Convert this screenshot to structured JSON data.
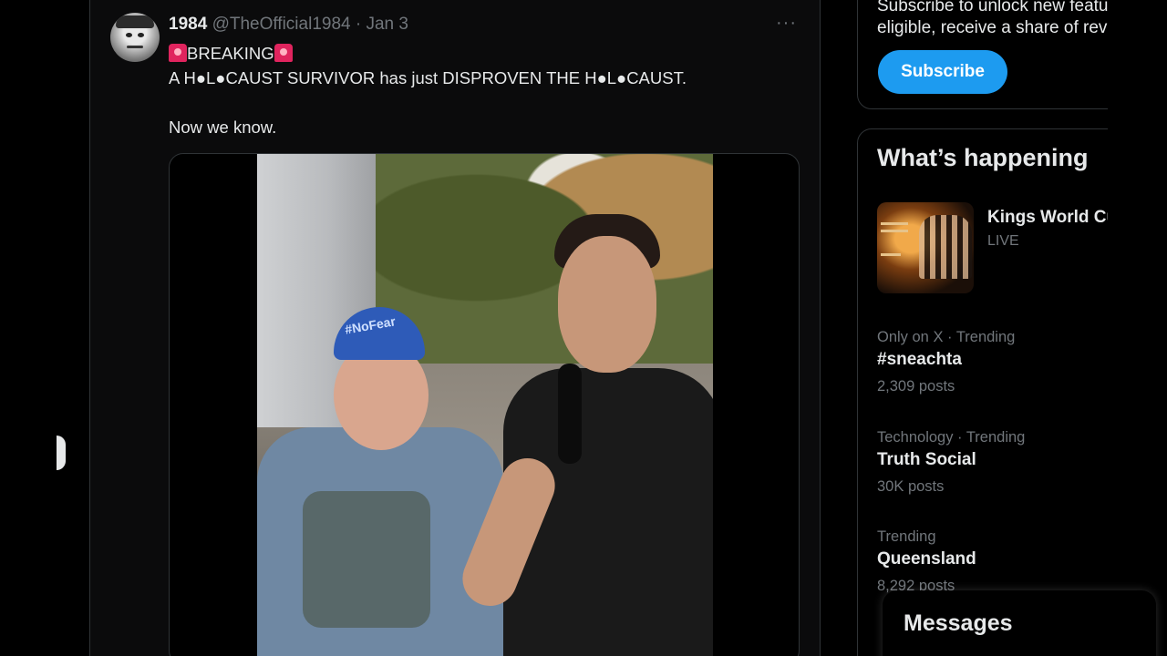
{
  "tweet": {
    "display_name": "1984",
    "handle": "@TheOfficial1984",
    "separator": "·",
    "date": "Jan 3",
    "more": "···",
    "line1": "BREAKING",
    "line2": "A H●L●CAUST SURVIVOR has just  DISPROVEN THE H●L●CAUST.",
    "line3": "Now we know.",
    "video_cap_text": "#NoFear"
  },
  "sidebar": {
    "premium_text_line1": "Subscribe to unlock new features and if",
    "premium_text_line2": "eligible, receive a share of revenue.",
    "subscribe_label": "Subscribe",
    "trends_title": "What’s happening",
    "live": {
      "title": "Kings World Cup",
      "badge": "LIVE"
    },
    "trends": [
      {
        "meta": "Only on X · Trending",
        "name": "#sneachta",
        "count": "2,309 posts"
      },
      {
        "meta": "Technology · Trending",
        "name": "Truth Social",
        "count": "30K posts"
      },
      {
        "meta": "Trending",
        "name": "Queensland",
        "count": "8,292 posts"
      }
    ]
  },
  "messages": {
    "title": "Messages"
  },
  "colors": {
    "accent": "#1d9bf0",
    "background": "#000000",
    "muted": "#71767b",
    "text": "#e7e9ea"
  }
}
